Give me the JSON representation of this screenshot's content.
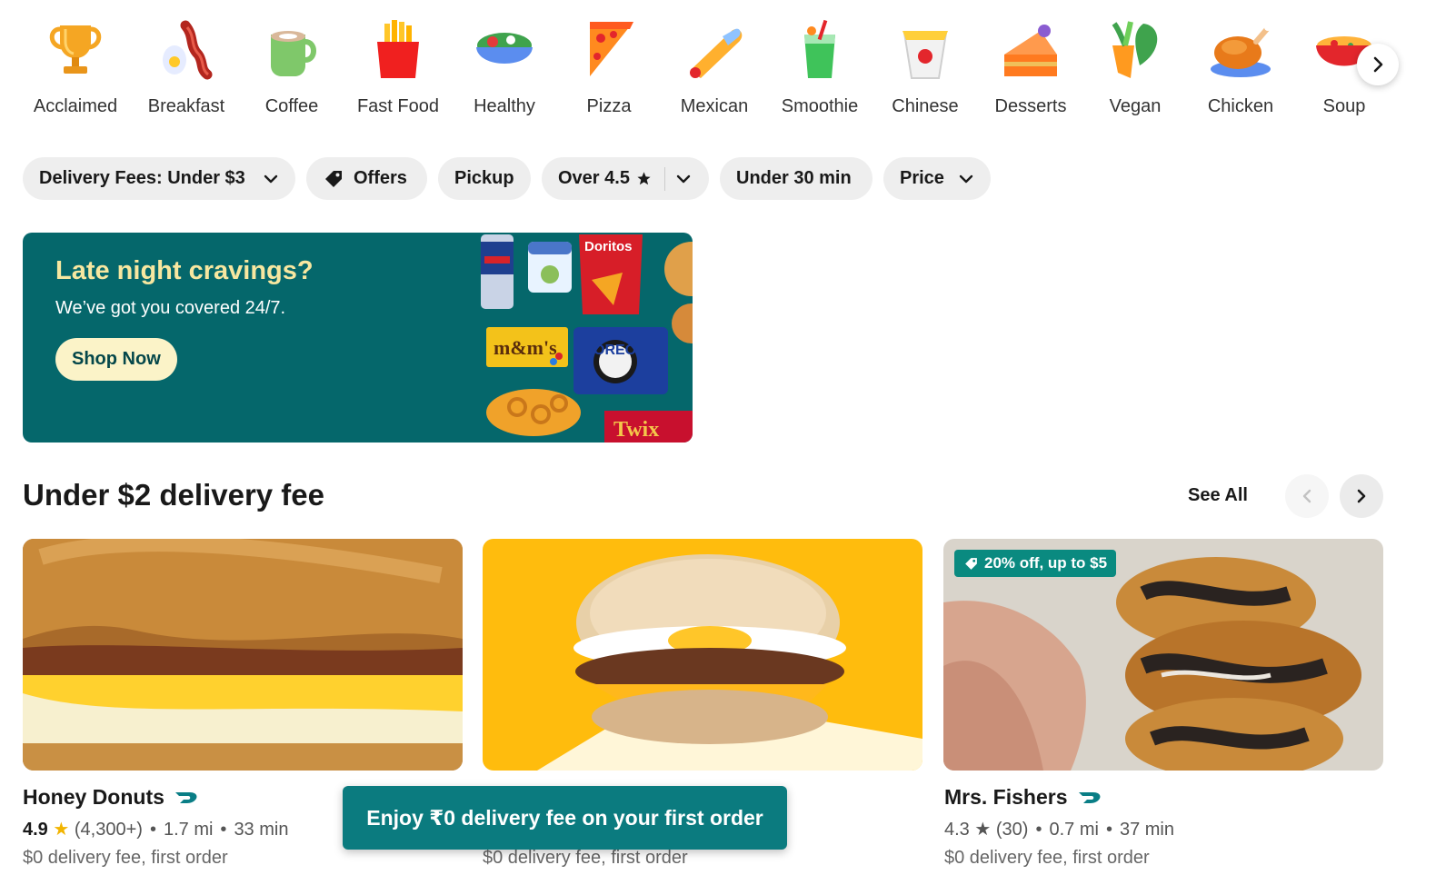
{
  "categories": [
    {
      "label": "Acclaimed",
      "icon": "trophy-icon"
    },
    {
      "label": "Breakfast",
      "icon": "bacon-egg-icon"
    },
    {
      "label": "Coffee",
      "icon": "coffee-cup-icon"
    },
    {
      "label": "Fast Food",
      "icon": "fries-icon"
    },
    {
      "label": "Healthy",
      "icon": "salad-bowl-icon"
    },
    {
      "label": "Pizza",
      "icon": "pizza-slice-icon"
    },
    {
      "label": "Mexican",
      "icon": "burrito-icon"
    },
    {
      "label": "Smoothie",
      "icon": "smoothie-cup-icon"
    },
    {
      "label": "Chinese",
      "icon": "takeout-box-icon"
    },
    {
      "label": "Desserts",
      "icon": "cake-slice-icon"
    },
    {
      "label": "Vegan",
      "icon": "vegetables-icon"
    },
    {
      "label": "Chicken",
      "icon": "roast-chicken-icon"
    },
    {
      "label": "Soup",
      "icon": "soup-bowl-icon"
    }
  ],
  "filters": {
    "delivery_fees": "Delivery Fees: Under $3",
    "offers": "Offers",
    "pickup": "Pickup",
    "rating": "Over 4.5",
    "time": "Under 30 min",
    "price": "Price"
  },
  "banner": {
    "title": "Late night cravings?",
    "subtitle": "We’ve got you covered 24/7.",
    "cta": "Shop Now",
    "products": [
      "Doritos",
      "m&m's",
      "OREO",
      "Twix"
    ]
  },
  "section": {
    "title": "Under $2 delivery fee",
    "see_all": "See All"
  },
  "stores": [
    {
      "name": "Honey Donuts",
      "rating": "4.9",
      "reviews": "(4,300+)",
      "distance": "1.7 mi",
      "time": "33 min",
      "fee": "$0 delivery fee, first order",
      "offer": ""
    },
    {
      "name": "",
      "rating": "",
      "reviews": "",
      "distance": "",
      "time": "",
      "fee": "$0 delivery fee, first order",
      "offer": ""
    },
    {
      "name": "Mrs. Fishers",
      "rating": "4.3",
      "reviews": "(30)",
      "distance": "0.7 mi",
      "time": "37 min",
      "fee": "$0 delivery fee, first order",
      "offer": "20% off, up to $5"
    }
  ],
  "toast": "Enjoy ₹0 delivery fee on your first order",
  "colors": {
    "banner_bg": "#05676b",
    "banner_title": "#f7e7a0",
    "toast_bg": "#0b7b7f",
    "dashpass_teal": "#0a7e86",
    "star": "#f2b400"
  }
}
